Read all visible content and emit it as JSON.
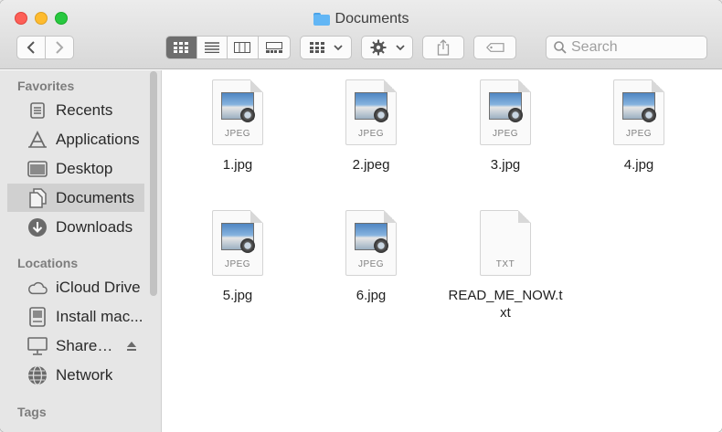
{
  "window": {
    "title": "Documents",
    "title_icon": "folder-icon"
  },
  "toolbar": {
    "back_icon": "chevron-left-icon",
    "forward_icon": "chevron-right-icon",
    "views": [
      "icon-view",
      "list-view",
      "column-view",
      "gallery-view"
    ],
    "active_view": "icon-view",
    "group_icon": "grid-group-icon",
    "action_icon": "gear-icon",
    "share_icon": "share-icon",
    "tag_icon": "tag-icon",
    "search_placeholder": "Search"
  },
  "sidebar": {
    "favorites_label": "Favorites",
    "favorites": [
      {
        "label": "Recents",
        "icon": "clock-icon"
      },
      {
        "label": "Applications",
        "icon": "applications-icon"
      },
      {
        "label": "Desktop",
        "icon": "desktop-icon"
      },
      {
        "label": "Documents",
        "icon": "document-icon",
        "selected": true
      },
      {
        "label": "Downloads",
        "icon": "download-icon"
      }
    ],
    "locations_label": "Locations",
    "locations": [
      {
        "label": "iCloud Drive",
        "icon": "cloud-icon"
      },
      {
        "label": "Install mac...",
        "icon": "disk-icon"
      },
      {
        "label": "Shared...",
        "icon": "monitor-icon"
      },
      {
        "label": "Network",
        "icon": "globe-icon"
      }
    ],
    "tags_label": "Tags"
  },
  "files": [
    {
      "name": "1.jpg",
      "ext": "JPEG"
    },
    {
      "name": "2.jpeg",
      "ext": "JPEG"
    },
    {
      "name": "3.jpg",
      "ext": "JPEG"
    },
    {
      "name": "4.jpg",
      "ext": "JPEG"
    },
    {
      "name": "5.jpg",
      "ext": "JPEG"
    },
    {
      "name": "6.jpg",
      "ext": "JPEG"
    },
    {
      "name": "READ_ME_NOW.txt",
      "ext": "TXT"
    }
  ],
  "colors": {
    "close": "#fd5f57",
    "minimize": "#febb2e",
    "maximize": "#28c840",
    "folder_accent": "#62b6f5"
  }
}
